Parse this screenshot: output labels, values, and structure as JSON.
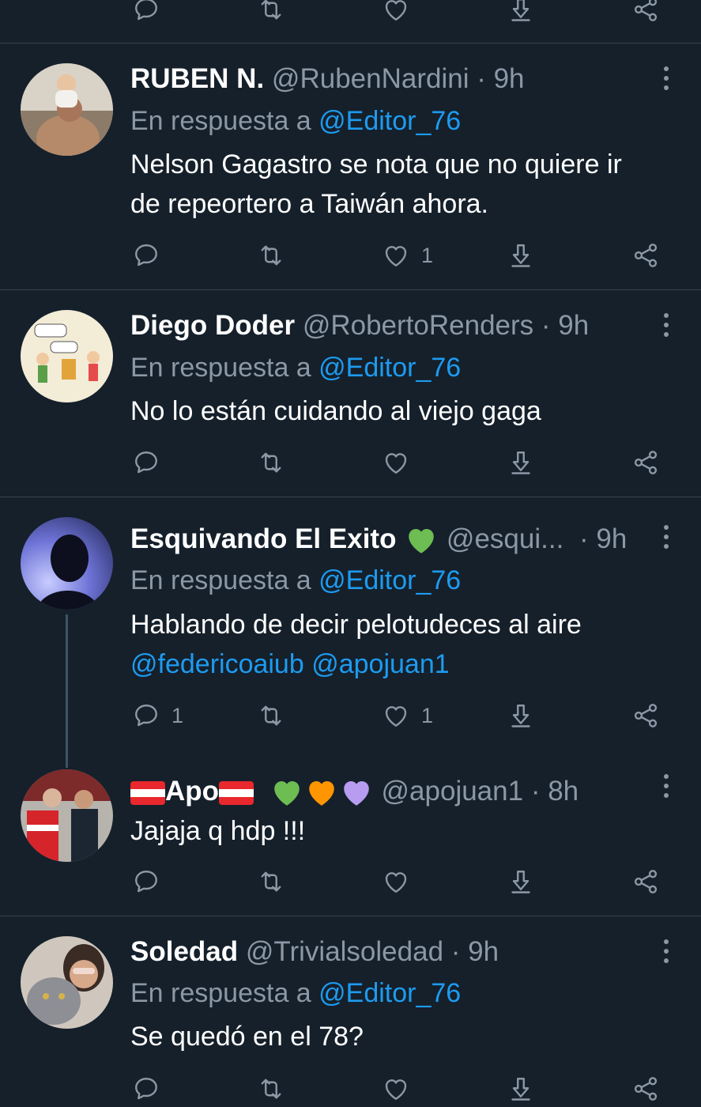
{
  "reply_label": "En respuesta a",
  "colors": {
    "background": "#15202b",
    "divider": "#38444d",
    "muted": "#8b98a5",
    "link": "#1d9bf0",
    "green_heart": "#6dbd52",
    "orange_heart": "#ff9500",
    "purple_heart": "#b79cf0"
  },
  "tweets": [
    {
      "name": "RUBEN N.",
      "handle": "@RubenNardini",
      "time": "9h",
      "reply_to": "@Editor_76",
      "text_lines": [
        "Nelson Gagastro se nota que no quiere ir",
        "de repeortero a Taiwán ahora."
      ],
      "reply_count": "",
      "like_count": "1"
    },
    {
      "name": "Diego Doder",
      "handle": "@RobertoRenders",
      "time": "9h",
      "reply_to": "@Editor_76",
      "text_lines": [
        "No lo están cuidando al viejo gaga"
      ],
      "reply_count": "",
      "like_count": ""
    },
    {
      "name": "Esquivando El Exito",
      "handle": "@esqui...",
      "time": "9h",
      "reply_to": "@Editor_76",
      "text_lines": [
        "Hablando de decir pelotudeces al aire"
      ],
      "text_mentions": "@federicoaiub @apojuan1",
      "reply_count": "1",
      "like_count": "1"
    },
    {
      "name": "Apo",
      "handle": "@apojuan1",
      "time": "8h",
      "reply_to": "",
      "text_lines": [
        "Jajaja q hdp !!!"
      ],
      "reply_count": "",
      "like_count": ""
    },
    {
      "name": "Soledad",
      "handle": "@Trivialsoledad",
      "time": "9h",
      "reply_to": "@Editor_76",
      "text_lines": [
        "Se quedó en el 78?"
      ],
      "reply_count": "",
      "like_count": ""
    }
  ],
  "icons": [
    "reply-icon",
    "retweet-icon",
    "like-icon",
    "download-icon",
    "share-icon",
    "more-icon"
  ]
}
